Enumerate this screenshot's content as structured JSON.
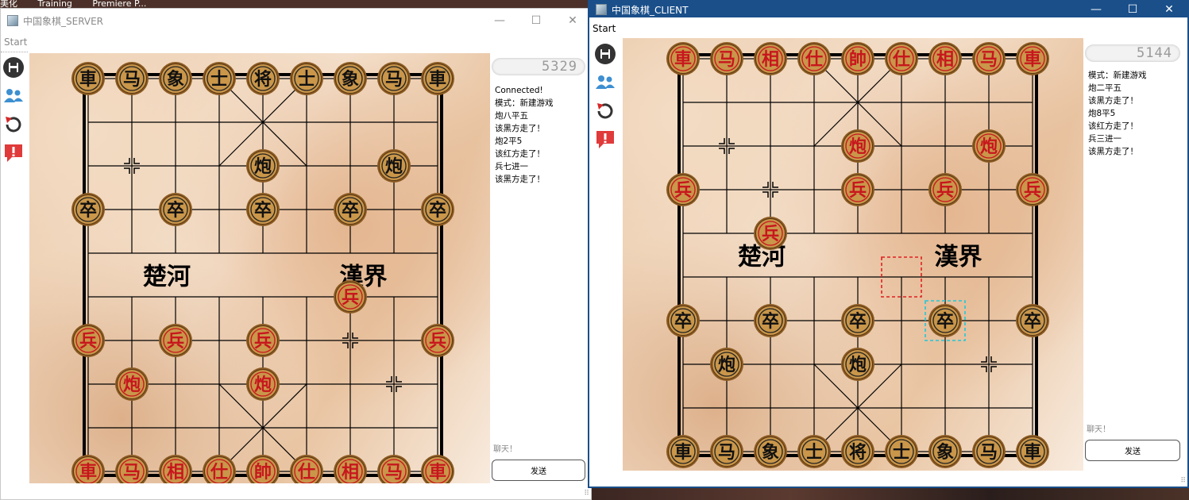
{
  "desktop": {
    "taskbar_items": [
      "美化",
      "Training",
      "Premiere P..."
    ]
  },
  "server_window": {
    "title": "中国象棋_SERVER",
    "controls": {
      "minimize": "—",
      "maximize": "☐",
      "close": "✕"
    },
    "menu": [
      "Start"
    ],
    "toolbar": [
      "save-icon",
      "users-icon",
      "undo-icon",
      "report-icon"
    ],
    "timer": "5329",
    "log": [
      "Connected!",
      "模式：新建游戏",
      "炮八平五",
      "该黑方走了！",
      "炮2平5",
      "该红方走了！",
      "兵七进一",
      "该黑方走了！"
    ],
    "chat_label": "聊天！",
    "send_label": "发送",
    "river": {
      "left": "楚河",
      "right": "漢界"
    },
    "pieces": [
      {
        "c": 0,
        "r": 0,
        "t": "車",
        "s": "b"
      },
      {
        "c": 1,
        "r": 0,
        "t": "马",
        "s": "b"
      },
      {
        "c": 2,
        "r": 0,
        "t": "象",
        "s": "b"
      },
      {
        "c": 3,
        "r": 0,
        "t": "士",
        "s": "b"
      },
      {
        "c": 4,
        "r": 0,
        "t": "将",
        "s": "b"
      },
      {
        "c": 5,
        "r": 0,
        "t": "士",
        "s": "b"
      },
      {
        "c": 6,
        "r": 0,
        "t": "象",
        "s": "b"
      },
      {
        "c": 7,
        "r": 0,
        "t": "马",
        "s": "b"
      },
      {
        "c": 8,
        "r": 0,
        "t": "車",
        "s": "b"
      },
      {
        "c": 4,
        "r": 2,
        "t": "炮",
        "s": "b"
      },
      {
        "c": 7,
        "r": 2,
        "t": "炮",
        "s": "b"
      },
      {
        "c": 0,
        "r": 3,
        "t": "卒",
        "s": "b"
      },
      {
        "c": 2,
        "r": 3,
        "t": "卒",
        "s": "b"
      },
      {
        "c": 4,
        "r": 3,
        "t": "卒",
        "s": "b"
      },
      {
        "c": 6,
        "r": 3,
        "t": "卒",
        "s": "b"
      },
      {
        "c": 8,
        "r": 3,
        "t": "卒",
        "s": "b"
      },
      {
        "c": 6,
        "r": 5,
        "t": "兵",
        "s": "r"
      },
      {
        "c": 0,
        "r": 6,
        "t": "兵",
        "s": "r"
      },
      {
        "c": 2,
        "r": 6,
        "t": "兵",
        "s": "r"
      },
      {
        "c": 4,
        "r": 6,
        "t": "兵",
        "s": "r"
      },
      {
        "c": 8,
        "r": 6,
        "t": "兵",
        "s": "r"
      },
      {
        "c": 1,
        "r": 7,
        "t": "炮",
        "s": "r"
      },
      {
        "c": 4,
        "r": 7,
        "t": "炮",
        "s": "r"
      },
      {
        "c": 0,
        "r": 9,
        "t": "車",
        "s": "r"
      },
      {
        "c": 1,
        "r": 9,
        "t": "马",
        "s": "r"
      },
      {
        "c": 2,
        "r": 9,
        "t": "相",
        "s": "r"
      },
      {
        "c": 3,
        "r": 9,
        "t": "仕",
        "s": "r"
      },
      {
        "c": 4,
        "r": 9,
        "t": "帥",
        "s": "r"
      },
      {
        "c": 5,
        "r": 9,
        "t": "仕",
        "s": "r"
      },
      {
        "c": 6,
        "r": 9,
        "t": "相",
        "s": "r"
      },
      {
        "c": 7,
        "r": 9,
        "t": "马",
        "s": "r"
      },
      {
        "c": 8,
        "r": 9,
        "t": "車",
        "s": "r"
      }
    ],
    "markers": [
      {
        "c": 1,
        "r": 2
      },
      {
        "c": 6,
        "r": 6
      },
      {
        "c": 7,
        "r": 7
      }
    ],
    "highlights": []
  },
  "client_window": {
    "title": "中国象棋_CLIENT",
    "controls": {
      "minimize": "—",
      "maximize": "☐",
      "close": "✕"
    },
    "menu": [
      "Start"
    ],
    "toolbar": [
      "save-icon",
      "users-icon",
      "undo-icon",
      "report-icon"
    ],
    "timer": "5144",
    "log": [
      "模式：新建游戏",
      "炮二平五",
      "该黑方走了！",
      "炮8平5",
      "该红方走了！",
      "兵三进一",
      "该黑方走了！"
    ],
    "chat_label": "聊天！",
    "send_label": "发送",
    "river": {
      "left": "楚河",
      "right": "漢界"
    },
    "pieces": [
      {
        "c": 0,
        "r": 0,
        "t": "車",
        "s": "r"
      },
      {
        "c": 1,
        "r": 0,
        "t": "马",
        "s": "r"
      },
      {
        "c": 2,
        "r": 0,
        "t": "相",
        "s": "r"
      },
      {
        "c": 3,
        "r": 0,
        "t": "仕",
        "s": "r"
      },
      {
        "c": 4,
        "r": 0,
        "t": "帥",
        "s": "r"
      },
      {
        "c": 5,
        "r": 0,
        "t": "仕",
        "s": "r"
      },
      {
        "c": 6,
        "r": 0,
        "t": "相",
        "s": "r"
      },
      {
        "c": 7,
        "r": 0,
        "t": "马",
        "s": "r"
      },
      {
        "c": 8,
        "r": 0,
        "t": "車",
        "s": "r"
      },
      {
        "c": 4,
        "r": 2,
        "t": "炮",
        "s": "r"
      },
      {
        "c": 7,
        "r": 2,
        "t": "炮",
        "s": "r"
      },
      {
        "c": 0,
        "r": 3,
        "t": "兵",
        "s": "r"
      },
      {
        "c": 4,
        "r": 3,
        "t": "兵",
        "s": "r"
      },
      {
        "c": 6,
        "r": 3,
        "t": "兵",
        "s": "r"
      },
      {
        "c": 8,
        "r": 3,
        "t": "兵",
        "s": "r"
      },
      {
        "c": 2,
        "r": 4,
        "t": "兵",
        "s": "r"
      },
      {
        "c": 0,
        "r": 6,
        "t": "卒",
        "s": "b"
      },
      {
        "c": 2,
        "r": 6,
        "t": "卒",
        "s": "b"
      },
      {
        "c": 4,
        "r": 6,
        "t": "卒",
        "s": "b"
      },
      {
        "c": 6,
        "r": 6,
        "t": "卒",
        "s": "b"
      },
      {
        "c": 8,
        "r": 6,
        "t": "卒",
        "s": "b"
      },
      {
        "c": 1,
        "r": 7,
        "t": "炮",
        "s": "b"
      },
      {
        "c": 4,
        "r": 7,
        "t": "炮",
        "s": "b"
      },
      {
        "c": 0,
        "r": 9,
        "t": "車",
        "s": "b"
      },
      {
        "c": 1,
        "r": 9,
        "t": "马",
        "s": "b"
      },
      {
        "c": 2,
        "r": 9,
        "t": "象",
        "s": "b"
      },
      {
        "c": 3,
        "r": 9,
        "t": "士",
        "s": "b"
      },
      {
        "c": 4,
        "r": 9,
        "t": "将",
        "s": "b"
      },
      {
        "c": 5,
        "r": 9,
        "t": "士",
        "s": "b"
      },
      {
        "c": 6,
        "r": 9,
        "t": "象",
        "s": "b"
      },
      {
        "c": 7,
        "r": 9,
        "t": "马",
        "s": "b"
      },
      {
        "c": 8,
        "r": 9,
        "t": "車",
        "s": "b"
      }
    ],
    "markers": [
      {
        "c": 1,
        "r": 2
      },
      {
        "c": 2,
        "r": 3
      },
      {
        "c": 7,
        "r": 7
      }
    ],
    "highlights": [
      {
        "c": 5,
        "r": 5,
        "color": "#e02020"
      },
      {
        "c": 6,
        "r": 6,
        "color": "#20c8d8"
      }
    ]
  },
  "colors": {
    "red_piece": "#c8161d",
    "black_piece": "#111111",
    "piece_ring": "#8a5a22",
    "piece_face": "#c9964a",
    "client_titlebar": "#1a4f8a"
  }
}
